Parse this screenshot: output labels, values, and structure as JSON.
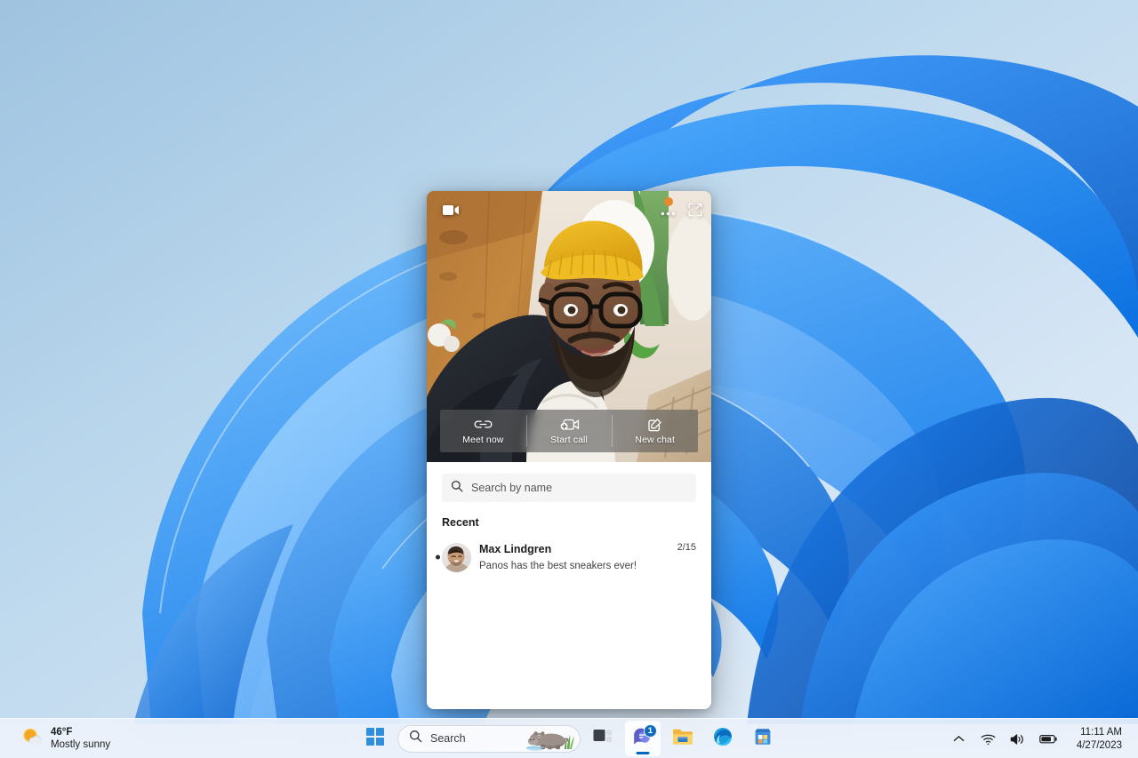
{
  "desktop": {
    "wallpaper_name": "windows-11-bloom",
    "background_colors": [
      "#9fc3e0",
      "#b7d4ea",
      "#cfe2f2",
      "#e3eef8"
    ],
    "bloom_colors": [
      "#0a84ff",
      "#1f8cff",
      "#3aa0ff",
      "#5bb4ff",
      "#86caff",
      "#0b63d6"
    ]
  },
  "teams_panel": {
    "camera_icon": "video-camera-icon",
    "more_options_icon": "more-options-icon",
    "expand_icon": "expand-popout-icon",
    "actions": [
      {
        "label": "Meet now",
        "icon": "link-chain-icon"
      },
      {
        "label": "Start call",
        "icon": "video-call-plus-icon"
      },
      {
        "label": "New chat",
        "icon": "compose-pencil-icon"
      }
    ],
    "search": {
      "placeholder": "Search by name",
      "value": "",
      "icon": "search-icon"
    },
    "recent_header": "Recent",
    "chats": [
      {
        "name": "Max Lindgren",
        "message": "Panos has the best sneakers ever!",
        "time": "2/15",
        "unread": true,
        "avatar": "person-avatar"
      }
    ]
  },
  "taskbar": {
    "weather": {
      "temperature": "46°F",
      "condition": "Mostly sunny",
      "icon": "sun-cloud-icon"
    },
    "start": {
      "label": "Start",
      "icon": "windows-logo-icon"
    },
    "search": {
      "placeholder": "Search",
      "value": "",
      "icon": "search-icon",
      "doodle": "hippo-illustration"
    },
    "apps": [
      {
        "name": "Task view",
        "icon": "task-view-icon",
        "active": false,
        "badge": ""
      },
      {
        "name": "Chat",
        "icon": "teams-chat-icon",
        "active": true,
        "badge": "1"
      },
      {
        "name": "File Explorer",
        "icon": "file-explorer-icon",
        "active": false,
        "badge": ""
      },
      {
        "name": "Microsoft Edge",
        "icon": "edge-browser-icon",
        "active": false,
        "badge": ""
      },
      {
        "name": "Microsoft Store",
        "icon": "microsoft-store-icon",
        "active": false,
        "badge": ""
      }
    ],
    "tray": {
      "chevron_icon": "chevron-up-icon",
      "network_icon": "wifi-icon",
      "volume_icon": "speaker-icon",
      "battery_icon": "battery-icon",
      "time": "11:11 AM",
      "date": "4/27/2023"
    }
  }
}
